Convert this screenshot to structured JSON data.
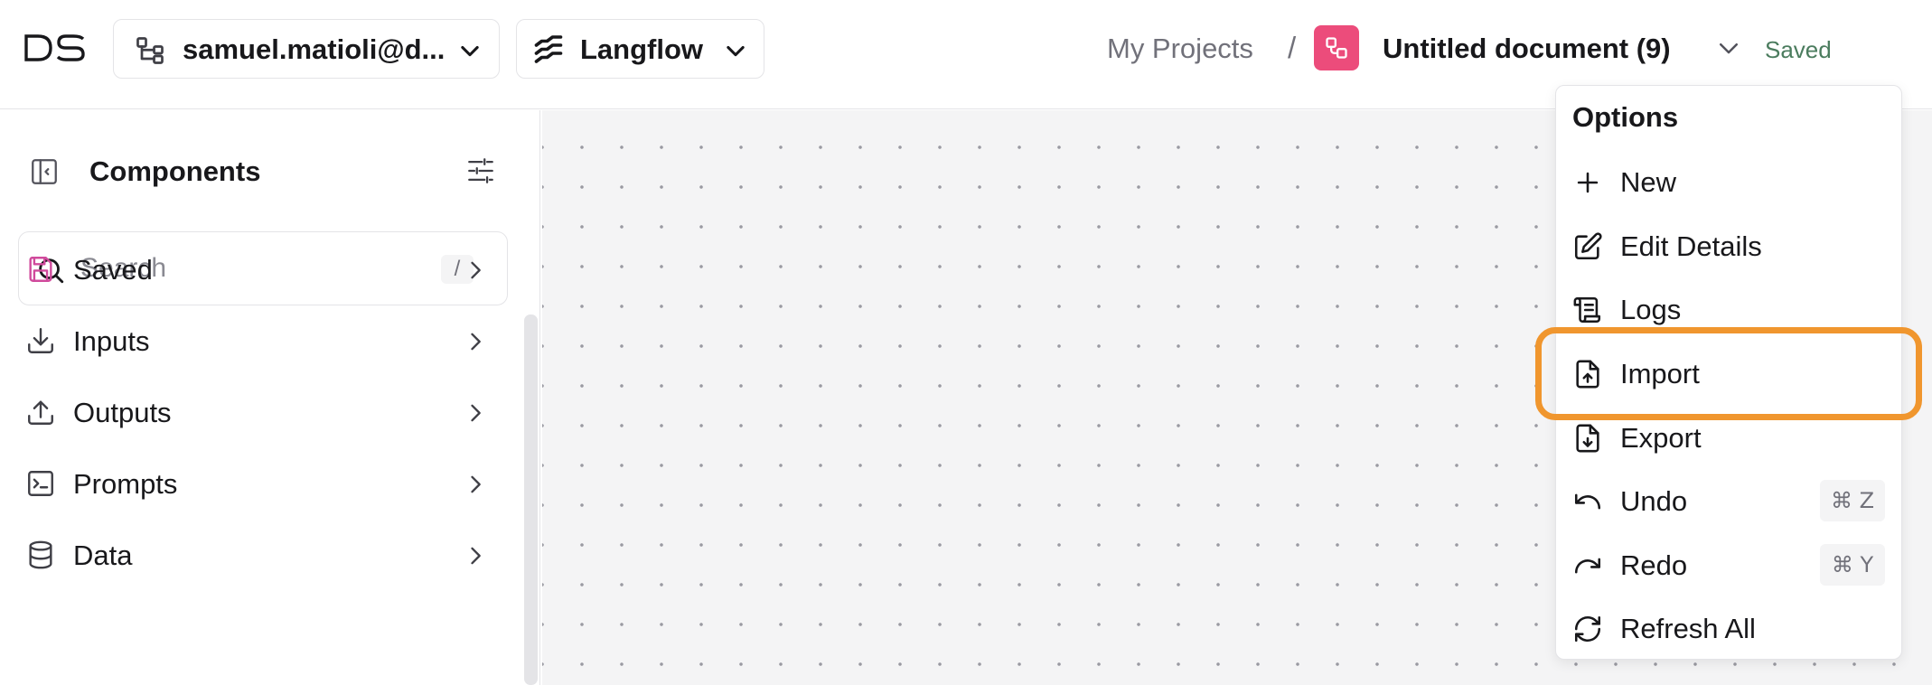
{
  "header": {
    "logo_text": "DS",
    "org_selector": {
      "label": "samuel.matioli@d...",
      "icon": "org-tree-icon"
    },
    "app_selector": {
      "label": "Langflow",
      "icon": "langflow-icon"
    },
    "breadcrumb": {
      "projects": "My Projects",
      "separator": "/",
      "document": "Untitled document (9)"
    },
    "save_status": "Saved",
    "flow_icon_color": "#ec4c7b",
    "saved_color": "#4b7c5e"
  },
  "sidebar": {
    "title": "Components",
    "search": {
      "placeholder": "Search",
      "shortcut": "/"
    },
    "categories": [
      {
        "label": "Saved",
        "icon": "save-icon",
        "icon_color": "#d04a9c"
      },
      {
        "label": "Inputs",
        "icon": "download-icon"
      },
      {
        "label": "Outputs",
        "icon": "upload-icon"
      },
      {
        "label": "Prompts",
        "icon": "terminal-icon"
      },
      {
        "label": "Data",
        "icon": "database-icon"
      }
    ]
  },
  "options_menu": {
    "title": "Options",
    "items": [
      {
        "label": "New",
        "icon": "plus-icon"
      },
      {
        "label": "Edit Details",
        "icon": "edit-icon"
      },
      {
        "label": "Logs",
        "icon": "scroll-icon"
      },
      {
        "label": "Import",
        "icon": "file-upload-icon",
        "highlighted": true
      },
      {
        "label": "Export",
        "icon": "file-download-icon"
      },
      {
        "label": "Undo",
        "icon": "undo-icon",
        "shortcut": "⌘ Z"
      },
      {
        "label": "Redo",
        "icon": "redo-icon",
        "shortcut": "⌘ Y"
      },
      {
        "label": "Refresh All",
        "icon": "refresh-icon"
      }
    ],
    "highlight_color": "#f0962e"
  }
}
